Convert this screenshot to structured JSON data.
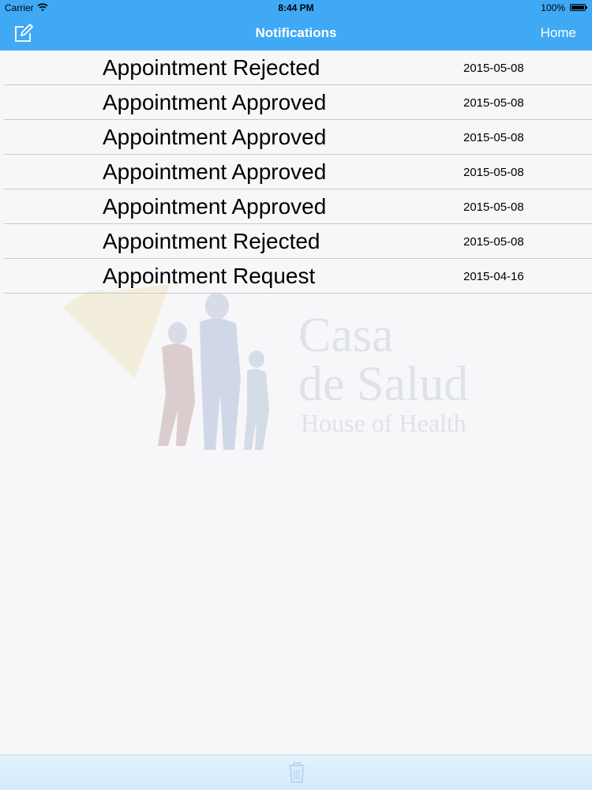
{
  "status_bar": {
    "carrier": "Carrier",
    "time": "8:44 PM",
    "battery": "100%"
  },
  "nav": {
    "title": "Notifications",
    "left_icon": "compose-icon",
    "right_label": "Home"
  },
  "notifications": [
    {
      "title": "Appointment Rejected",
      "date": "2015-05-08"
    },
    {
      "title": "Appointment Approved",
      "date": "2015-05-08"
    },
    {
      "title": "Appointment Approved",
      "date": "2015-05-08"
    },
    {
      "title": "Appointment Approved",
      "date": "2015-05-08"
    },
    {
      "title": "Appointment Approved",
      "date": "2015-05-08"
    },
    {
      "title": "Appointment Rejected",
      "date": "2015-05-08"
    },
    {
      "title": "Appointment Request",
      "date": "2015-04-16"
    }
  ],
  "watermark": {
    "line1": "Casa",
    "line2": "de Salud",
    "line3": "House of Health"
  },
  "toolbar": {
    "icon": "trash-icon"
  },
  "colors": {
    "nav_bar": "#3fa9f5",
    "background": "#f7f7f9",
    "toolbar": "#d4ecfb"
  }
}
